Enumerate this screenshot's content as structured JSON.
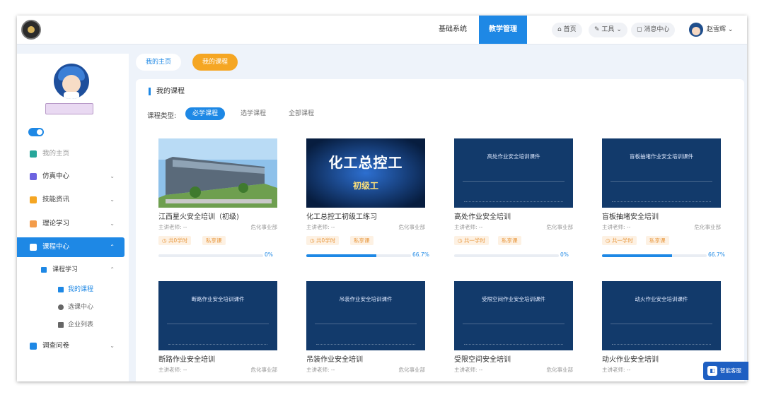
{
  "topbar": {
    "nav": [
      "基础系统",
      "教学管理"
    ],
    "home": "首页",
    "tools": "工具",
    "messages": "消息中心",
    "user": "赵雪辉"
  },
  "tabs": {
    "home": "我的主页",
    "mine": "我的课程"
  },
  "sidebar": {
    "items": [
      {
        "label": "我的主页",
        "icon": "house-icon",
        "color": "#26a69a"
      },
      {
        "label": "仿真中心",
        "icon": "monitor-icon",
        "color": "#6c63e0"
      },
      {
        "label": "技能资讯",
        "icon": "news-icon",
        "color": "#f5a623"
      },
      {
        "label": "理论学习",
        "icon": "book-icon",
        "color": "#f39c4a"
      },
      {
        "label": "课程中心",
        "icon": "course-icon",
        "color": "#ffffff"
      },
      {
        "label": "课程学习",
        "icon": "study-icon",
        "color": "#1e88e5"
      },
      {
        "label": "我的课程",
        "icon": "list-icon",
        "color": "#1e88e5"
      },
      {
        "label": "选课中心",
        "icon": "select-icon",
        "color": "#666666"
      },
      {
        "label": "企业列表",
        "icon": "company-icon",
        "color": "#666666"
      },
      {
        "label": "调查问卷",
        "icon": "survey-icon",
        "color": "#1e88e5"
      }
    ]
  },
  "panel": {
    "title": "我的课程",
    "filter_label": "课程类型:",
    "filters": [
      "必学课程",
      "选学课程",
      "全部课程"
    ]
  },
  "courses": [
    {
      "title": "江西星火安全培训（初级)",
      "teacher": "主讲老师: --",
      "dept": "危化事业部",
      "badges": [
        "共0学时",
        "私享课"
      ],
      "progress": "0%",
      "progress_value": 0,
      "thumb_text": "",
      "thumb_type": "photo"
    },
    {
      "title": "化工总控工初级工练习",
      "teacher": "主讲老师: --",
      "dept": "危化事业部",
      "badges": [
        "共0学时",
        "私享课"
      ],
      "progress": "66.7%",
      "progress_value": 66.7,
      "thumb_text": "化工总控工",
      "thumb_sub": "初级工",
      "thumb_type": "banner"
    },
    {
      "title": "高处作业安全培训",
      "teacher": "主讲老师: --",
      "dept": "危化事业部",
      "badges": [
        "共一学时",
        "私享课"
      ],
      "progress": "0%",
      "progress_value": 0,
      "thumb_text": "高处作业安全培训课件",
      "thumb_type": "slide"
    },
    {
      "title": "盲板抽堵安全培训",
      "teacher": "主讲老师: --",
      "dept": "危化事业部",
      "badges": [
        "共一学时",
        "私享课"
      ],
      "progress": "66.7%",
      "progress_value": 66.7,
      "thumb_text": "盲板抽堵作业安全培训课件",
      "thumb_type": "slide"
    },
    {
      "title": "断路作业安全培训",
      "teacher": "主讲老师: --",
      "dept": "危化事业部",
      "badges": [],
      "progress": "",
      "progress_value": 0,
      "thumb_text": "断路作业安全培训课件",
      "thumb_type": "slide"
    },
    {
      "title": "吊装作业安全培训",
      "teacher": "主讲老师: --",
      "dept": "危化事业部",
      "badges": [],
      "progress": "",
      "progress_value": 0,
      "thumb_text": "吊装作业安全培训课件",
      "thumb_type": "slide"
    },
    {
      "title": "受限空间安全培训",
      "teacher": "主讲老师: --",
      "dept": "危化事业部",
      "badges": [],
      "progress": "",
      "progress_value": 0,
      "thumb_text": "受限空间作业安全培训课件",
      "thumb_type": "slide"
    },
    {
      "title": "动火作业安全培训",
      "teacher": "主讲老师: --",
      "dept": "危化",
      "badges": [],
      "progress": "",
      "progress_value": 0,
      "thumb_text": "动火作业安全培训课件",
      "thumb_type": "slide"
    }
  ],
  "float_button": "智能客服",
  "colors": {
    "accent": "#1e88e5",
    "orange": "#f5a623",
    "slide_bg": "#123a6b"
  }
}
